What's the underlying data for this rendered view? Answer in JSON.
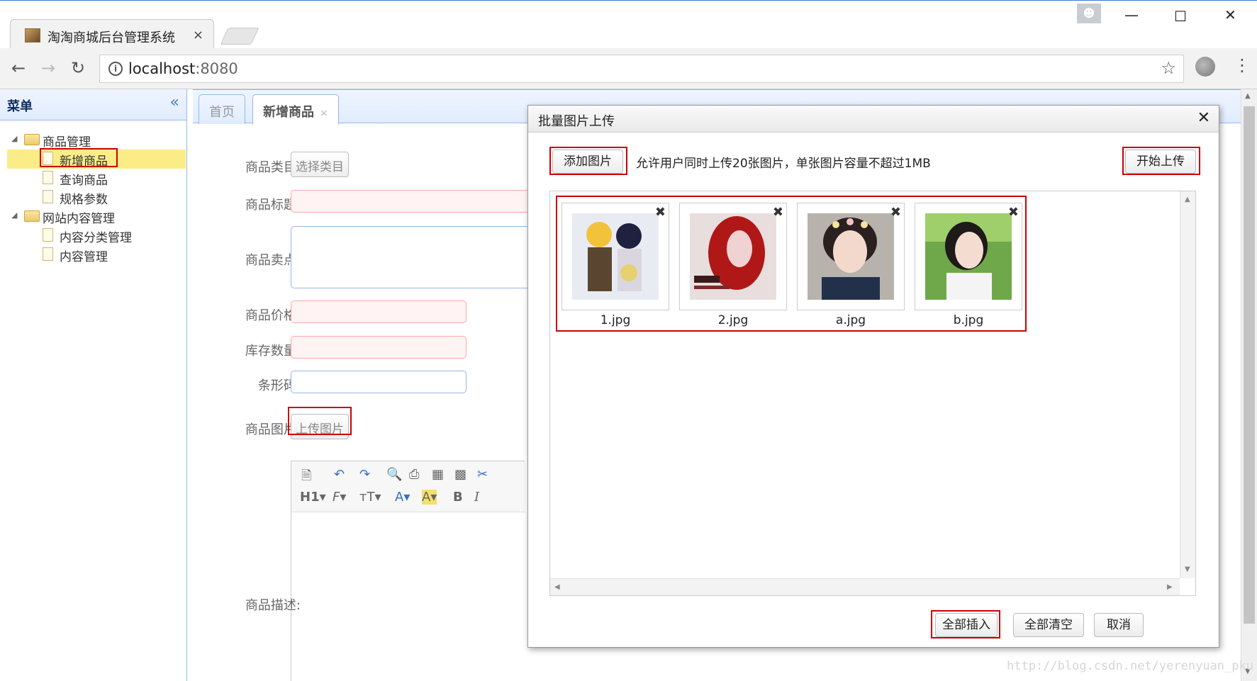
{
  "browser": {
    "tab_title": "淘淘商城后台管理系统",
    "tab_close": "×",
    "url_host": "localhost",
    "url_port": ":8080"
  },
  "sidebar": {
    "title": "菜单",
    "collapse_glyph": "«",
    "tree": [
      {
        "label": "商品管理",
        "type": "folder",
        "children": [
          "新增商品",
          "查询商品",
          "规格参数"
        ]
      },
      {
        "label": "网站内容管理",
        "type": "folder",
        "children": [
          "内容分类管理",
          "内容管理"
        ]
      }
    ],
    "selected": "新增商品"
  },
  "tabs": {
    "home": "首页",
    "current": "新增商品",
    "current_close": "×"
  },
  "form": {
    "category_label": "商品类目:",
    "category_button": "选择类目",
    "title_label": "商品标题:",
    "sellpoint_label": "商品卖点:",
    "price_label": "商品价格:",
    "stock_label": "库存数量:",
    "barcode_label": "条形码:",
    "image_label": "商品图片:",
    "upload_button": "上传图片",
    "desc_label": "商品描述:"
  },
  "dialog": {
    "title": "批量图片上传",
    "add_button": "添加图片",
    "hint": "允许用户同时上传20张图片，单张图片容量不超过1MB",
    "start_button": "开始上传",
    "files": [
      "1.jpg",
      "2.jpg",
      "a.jpg",
      "b.jpg"
    ],
    "insert_all": "全部插入",
    "clear_all": "全部清空",
    "cancel": "取消"
  },
  "watermark": "http://blog.csdn.net/yerenyuan_pku",
  "colors": {
    "highlight_red": "#cc0000",
    "easyui_border": "#95b8e7",
    "selected_bg": "#fbec88"
  }
}
